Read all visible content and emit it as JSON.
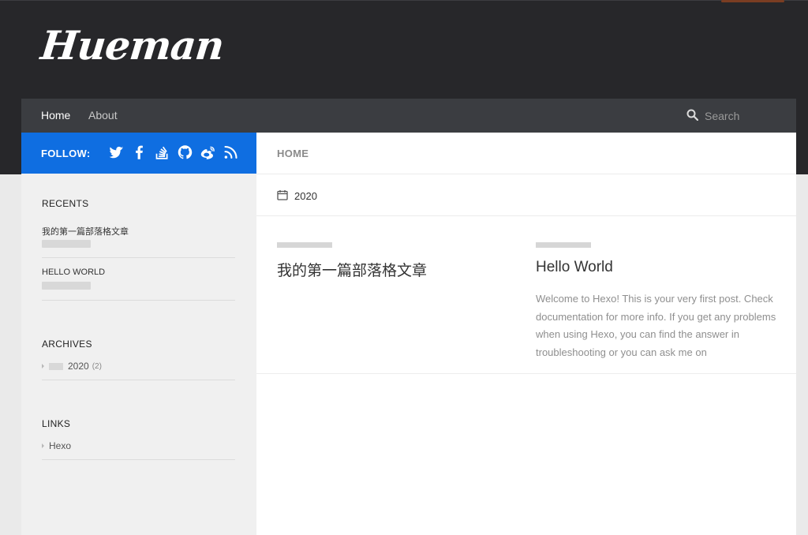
{
  "site": {
    "logo": "Hueman"
  },
  "nav": {
    "items": [
      {
        "label": "Home",
        "active": true
      },
      {
        "label": "About",
        "active": false
      }
    ],
    "search_placeholder": "Search"
  },
  "follow": {
    "label": "FOLLOW:",
    "icons": [
      "twitter-icon",
      "facebook-icon",
      "stackoverflow-icon",
      "github-icon",
      "weibo-icon",
      "rss-icon"
    ]
  },
  "sidebar": {
    "recents_title": "RECENTS",
    "recents": [
      {
        "title": "我的第一篇部落格文章"
      },
      {
        "title": "HELLO WORLD"
      }
    ],
    "archives_title": "ARCHIVES",
    "archives": [
      {
        "label": "2020",
        "count": "(2)"
      }
    ],
    "links_title": "LINKS",
    "links": [
      {
        "label": "Hexo"
      }
    ]
  },
  "main": {
    "breadcrumb": "HOME",
    "archive_label": "2020",
    "posts": [
      {
        "title": "我的第一篇部落格文章",
        "excerpt": ""
      },
      {
        "title": "Hello World",
        "excerpt": "Welcome to Hexo! This is your very first post. Check documentation for more info. If you get any problems when using Hexo, you can find the answer in troubleshooting or you can ask me on"
      }
    ]
  },
  "colors": {
    "header_bg": "#27272a",
    "nav_bg": "#3b3d41",
    "follow_bg": "#0f6ee1",
    "sidebar_bg": "#f0f0f0"
  }
}
